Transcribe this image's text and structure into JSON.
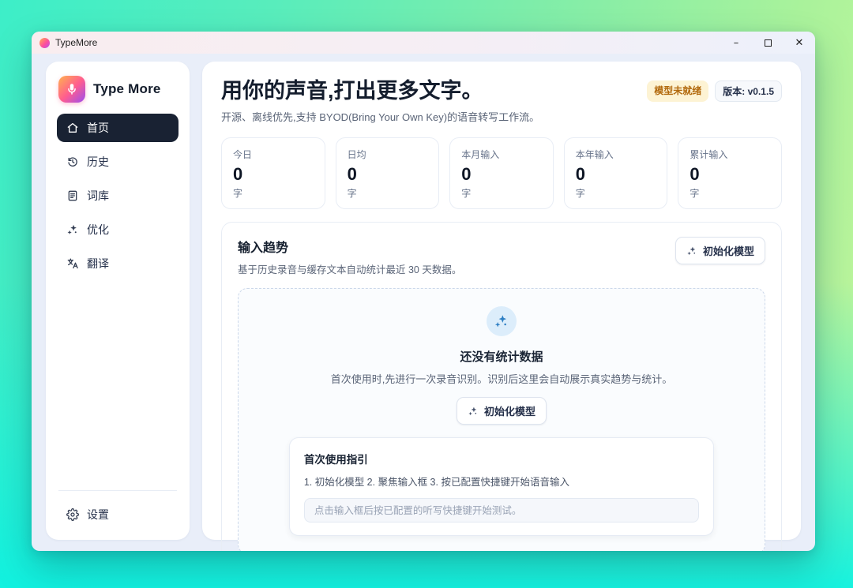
{
  "window": {
    "title": "TypeMore",
    "controls": {
      "minimize": "–",
      "close": "✕"
    }
  },
  "sidebar": {
    "brand": "Type More",
    "items": [
      {
        "icon": "home-icon",
        "label": "首页",
        "active": true
      },
      {
        "icon": "history-icon",
        "label": "历史",
        "active": false
      },
      {
        "icon": "lexicon-icon",
        "label": "词库",
        "active": false
      },
      {
        "icon": "sparkles-icon",
        "label": "优化",
        "active": false
      },
      {
        "icon": "translate-icon",
        "label": "翻译",
        "active": false
      }
    ],
    "settings": {
      "icon": "gear-icon",
      "label": "设置"
    }
  },
  "header": {
    "title": "用你的声音,打出更多文字。",
    "subtitle": "开源、离线优先,支持 BYOD(Bring Your Own Key)的语音转写工作流。",
    "badges": {
      "model_status": "模型未就绪",
      "version": "版本: v0.1.5"
    }
  },
  "stats": {
    "unit": "字",
    "cards": [
      {
        "label": "今日",
        "value": "0"
      },
      {
        "label": "日均",
        "value": "0"
      },
      {
        "label": "本月输入",
        "value": "0"
      },
      {
        "label": "本年输入",
        "value": "0"
      },
      {
        "label": "累计输入",
        "value": "0"
      }
    ]
  },
  "trend": {
    "title": "输入趋势",
    "subtitle": "基于历史录音与缓存文本自动统计最近 30 天数据。",
    "init_button_label": "初始化模型",
    "empty": {
      "title": "还没有统计数据",
      "description": "首次使用时,先进行一次录音识别。识别后这里会自动展示真实趋势与统计。",
      "button_label": "初始化模型"
    },
    "guide": {
      "title": "首次使用指引",
      "steps": "1. 初始化模型 2. 聚焦输入框 3. 按已配置快捷键开始语音输入",
      "input_placeholder": "点击输入框后按已配置的听写快捷键开始测试。"
    }
  },
  "colors": {
    "background_gradient": [
      "#3deec8",
      "#a9f29b",
      "#0ef2e2"
    ],
    "titlebar_bg": "#f9edef",
    "content_bg": "#e9eef9",
    "active_nav_bg": "#192233",
    "warning_badge_bg": "#fdf3d4",
    "warning_badge_text": "#b2690d",
    "empty_icon_bg": "#dcedfb",
    "empty_icon_fg": "#2e7fc4",
    "logo_gradient": [
      "#ffb24e",
      "#ff5d8f",
      "#9b4df0"
    ]
  }
}
